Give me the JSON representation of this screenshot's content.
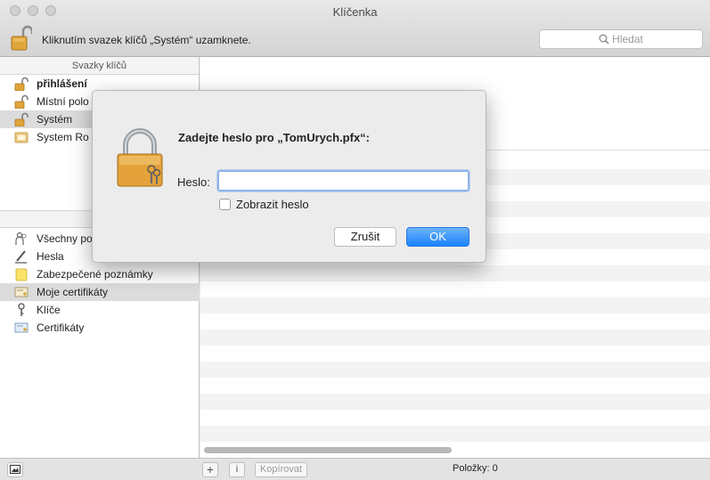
{
  "window": {
    "title": "Klíčenka"
  },
  "toolbar": {
    "lock_message": "Kliknutím svazek klíčů „Systém“ uzamknete.",
    "search_placeholder": "Hledat"
  },
  "sidebar": {
    "keychains_header": "Svazky klíčů",
    "keychains": [
      {
        "label": "přihlášení",
        "icon": "unlocked-padlock-icon"
      },
      {
        "label": "Místní polo",
        "icon": "unlocked-padlock-icon"
      },
      {
        "label": "Systém",
        "icon": "unlocked-padlock-icon"
      },
      {
        "label": "System Ro",
        "icon": "keychain-folder-icon"
      }
    ],
    "categories_header": "Kat",
    "categories": [
      {
        "label": "Všechny po",
        "icon": "people-icon"
      },
      {
        "label": "Hesla",
        "icon": "pen-icon"
      },
      {
        "label": "Zabezpečené poznámky",
        "icon": "note-icon"
      },
      {
        "label": "Moje certifikáty",
        "icon": "certificate-icon"
      },
      {
        "label": "Klíče",
        "icon": "key-icon"
      },
      {
        "label": "Certifikáty",
        "icon": "certificate-icon"
      }
    ]
  },
  "bottombar": {
    "add_label": "+",
    "info_label": "i",
    "copy_label": "Kopírovat",
    "items_count": "Položky: 0"
  },
  "dialog": {
    "title": "Zadejte heslo pro „TomUrych.pfx“:",
    "password_label": "Heslo:",
    "password_value": "",
    "show_password_label": "Zobrazit heslo",
    "show_password_checked": false,
    "cancel_label": "Zrušit",
    "ok_label": "OK"
  },
  "colors": {
    "accent": "#1a82fb",
    "selection": "#dcdcdc"
  }
}
